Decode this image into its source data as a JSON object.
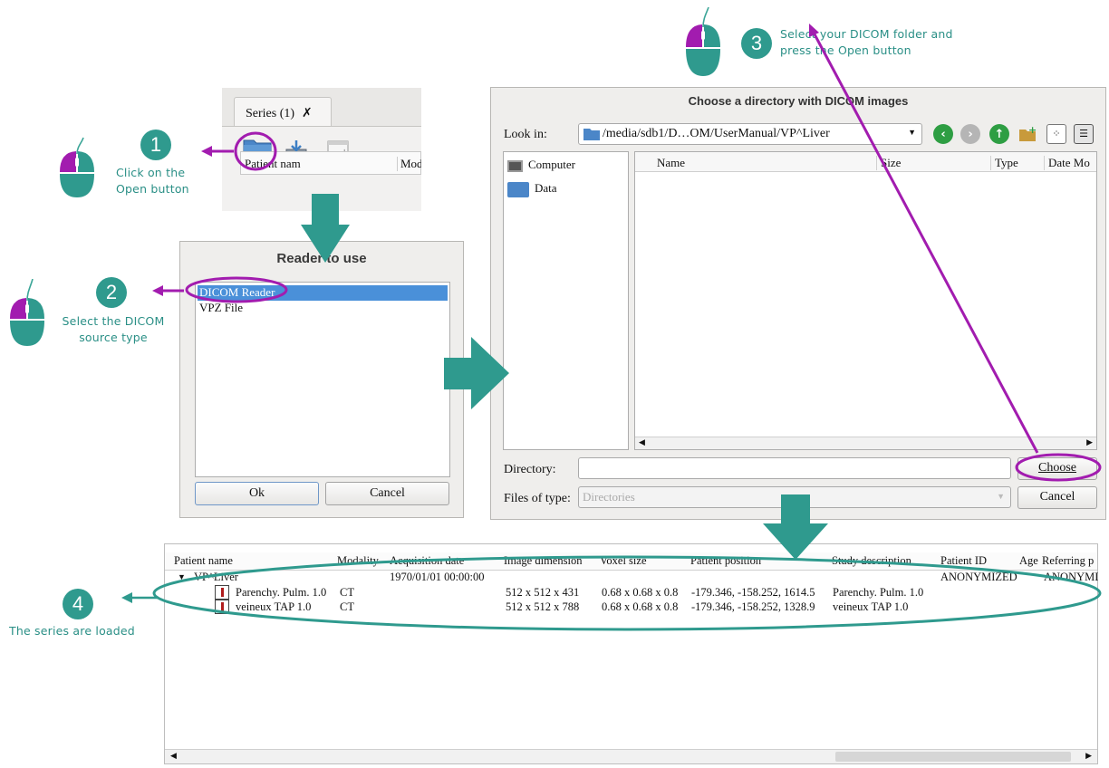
{
  "steps": [
    {
      "number": "1",
      "lines": [
        "Click on the",
        "Open button"
      ]
    },
    {
      "number": "2",
      "lines": [
        "Select the DICOM",
        "source type"
      ]
    },
    {
      "number": "3",
      "lines": [
        "Select your DICOM folder and",
        "press the Open button"
      ]
    },
    {
      "number": "4",
      "lines": [
        "The series are loaded"
      ]
    }
  ],
  "series_panel": {
    "tab_label": "Series (1)",
    "tab_close": "✗",
    "column_patient": "Patient nam",
    "column_modality": "Mod"
  },
  "reader_dialog": {
    "title": "Reader to use",
    "items": [
      "DICOM Reader",
      "VPZ File"
    ],
    "ok_label": "Ok",
    "cancel_label": "Cancel"
  },
  "file_dialog": {
    "title": "Choose a directory with DICOM images",
    "look_in_label": "Look in:",
    "path": "/media/sdb1/D…OM/UserManual/VP^Liver",
    "places": [
      "Computer",
      "Data"
    ],
    "columns": [
      "Name",
      "Size",
      "Type",
      "Date Mo"
    ],
    "directory_label": "Directory:",
    "directory_value": "",
    "files_of_type_label": "Files of type:",
    "files_of_type_value": "Directories",
    "choose_label": "Choose",
    "cancel_label": "Cancel"
  },
  "series_table": {
    "columns": [
      "Patient name",
      "Modality",
      "Acquisition date",
      "Image dimension",
      "Voxel size",
      "Patient position",
      "Study description",
      "Patient ID",
      "Age",
      "Referring p"
    ],
    "patient": {
      "name": "VP^Liver",
      "acquisition_date": "1970/01/01 00:00:00",
      "patient_id": "ANONYMIZED",
      "referring": "ANONYMI"
    },
    "rows": [
      {
        "name": "Parenchy. Pulm. 1.0",
        "modality": "CT",
        "dimension": "512 x 512 x 431",
        "voxel": "0.68 x 0.68 x 0.8",
        "position": "-179.346, -158.252, 1614.5",
        "study": "Parenchy. Pulm. 1.0"
      },
      {
        "name": "veineux TAP 1.0",
        "modality": "CT",
        "dimension": "512 x 512 x 788",
        "voxel": "0.68 x 0.68 x 0.8",
        "position": "-179.346, -158.252, 1328.9",
        "study": "veineux TAP 1.0"
      }
    ]
  },
  "colors": {
    "accent_teal": "#2f9a8e",
    "highlight_purple": "#a21caf",
    "selection_blue": "#4a90d9"
  }
}
